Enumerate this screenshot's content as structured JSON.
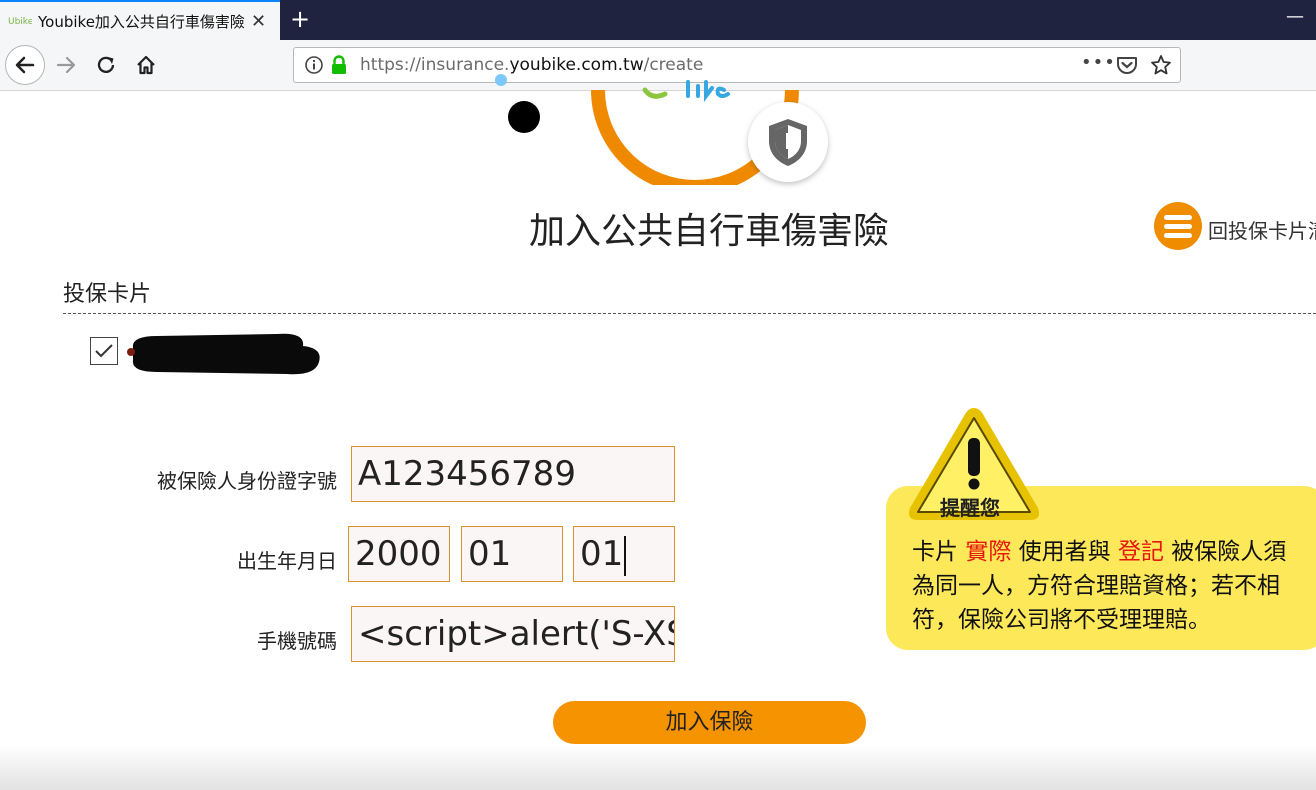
{
  "browser": {
    "tab_title": "Youbike加入公共自行車傷害險",
    "new_tab_symbol": "+",
    "close_symbol": "✕",
    "minimize_symbol": "—",
    "url_prefix": "https://insurance.",
    "url_domain": "youbike.com.tw",
    "url_path": "/create",
    "more_symbol": "•••"
  },
  "page": {
    "title": "加入公共自行車傷害險",
    "back_link": "回投保卡片清",
    "section_title": "投保卡片",
    "card_checked": true
  },
  "form": {
    "id_label": "被保險人身份證字號",
    "id_value": "A123456789",
    "birth_label": "出生年月日",
    "birth_year": "2000",
    "birth_month": "01",
    "birth_day": "01",
    "phone_label": "手機號碼",
    "phone_value": "<script>alert('S-XSS')",
    "submit_label": "加入保險"
  },
  "warning": {
    "badge": "提醒您",
    "text_1": "卡片 ",
    "highlight_1": "實際",
    "text_2": " 使用者與 ",
    "highlight_2": "登記",
    "text_3": " 被保險人須為同一人，方符合理賠資格；若不相符，保險公司將不受理理賠。"
  },
  "colors": {
    "accent_orange": "#f59400",
    "warning_yellow": "#fde85a",
    "highlight_red": "#e8160c",
    "field_border": "#d9922e",
    "browser_tabbar": "#202340"
  }
}
